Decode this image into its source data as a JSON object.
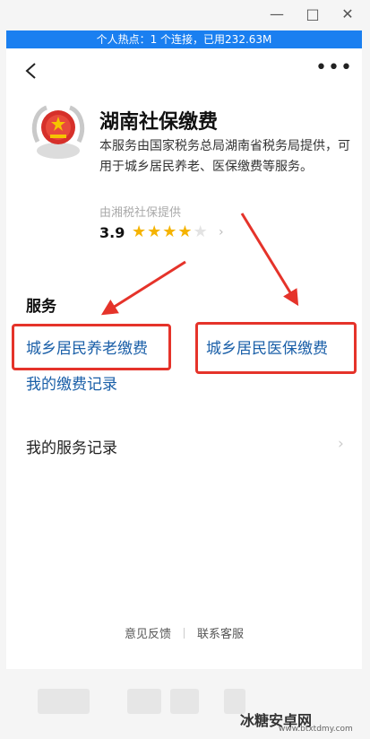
{
  "window": {
    "minimize_icon": "minimize-icon",
    "maximize_icon": "maximize-icon",
    "close_icon": "close-icon",
    "hotspot_text": "个人热点：1 个连接，已用232.63M"
  },
  "header": {
    "back_icon": "back-icon",
    "more_icon": "more-icon"
  },
  "app": {
    "logo_icon": "tax-emblem-icon",
    "title": "湖南社保缴费",
    "description": "本服务由国家税务总局湖南省税务局提供，可用于城乡居民养老、医保缴费等服务。",
    "provider": "由湘税社保提供",
    "rating": "3.9",
    "rating_value": 3.5,
    "rating_max": 5
  },
  "services": {
    "section_title": "服务",
    "items": [
      "城乡居民养老缴费",
      "城乡居民医保缴费",
      "我的缴费记录"
    ]
  },
  "records": {
    "label": "我的服务记录"
  },
  "footer": {
    "feedback": "意见反馈",
    "support": "联系客服"
  },
  "colors": {
    "accent_blue": "#1a7ff0",
    "service_link": "#1a5fa8",
    "annotation_red": "#e5332a",
    "star": "#f5b300"
  },
  "watermark": {
    "brand": "冰糖安卓网",
    "url": "www.btxtdmy.com"
  }
}
